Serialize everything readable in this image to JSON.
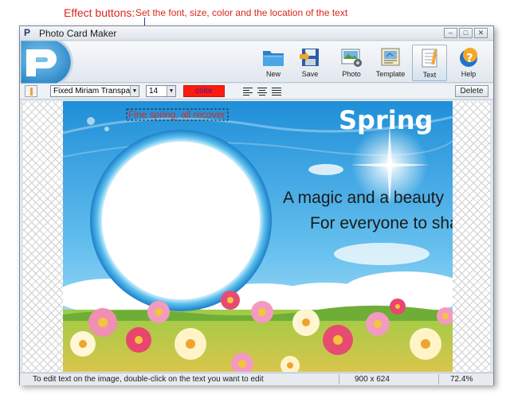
{
  "annotation": {
    "title": "Effect buttons:",
    "description": "Set the font, size, color and the location of the text"
  },
  "window": {
    "title": "Photo Card Maker",
    "controls": [
      "minimize",
      "maximize",
      "close"
    ]
  },
  "toolbar": {
    "buttons": [
      {
        "label": "New",
        "icon": "folder-icon"
      },
      {
        "label": "Save",
        "icon": "save-icon"
      },
      {
        "label": "Photo",
        "icon": "photo-icon"
      },
      {
        "label": "Template",
        "icon": "template-icon"
      },
      {
        "label": "Text",
        "icon": "text-icon",
        "active": true
      },
      {
        "label": "Help",
        "icon": "help-icon"
      }
    ]
  },
  "effects": {
    "font": "Fixed Miriam Transpa",
    "size": "14",
    "color_label": "color",
    "color_value": "#ff1a10",
    "delete_label": "Delete"
  },
  "card": {
    "heading": "Spring",
    "selected_text": "Fine spring, all recover",
    "line1": "A magic and a beauty",
    "line2": "For everyone to share"
  },
  "status": {
    "message": "To edit text on the image, double-click on the text you want to edit",
    "dimensions": "900 x 624",
    "zoom": "72.4%"
  }
}
